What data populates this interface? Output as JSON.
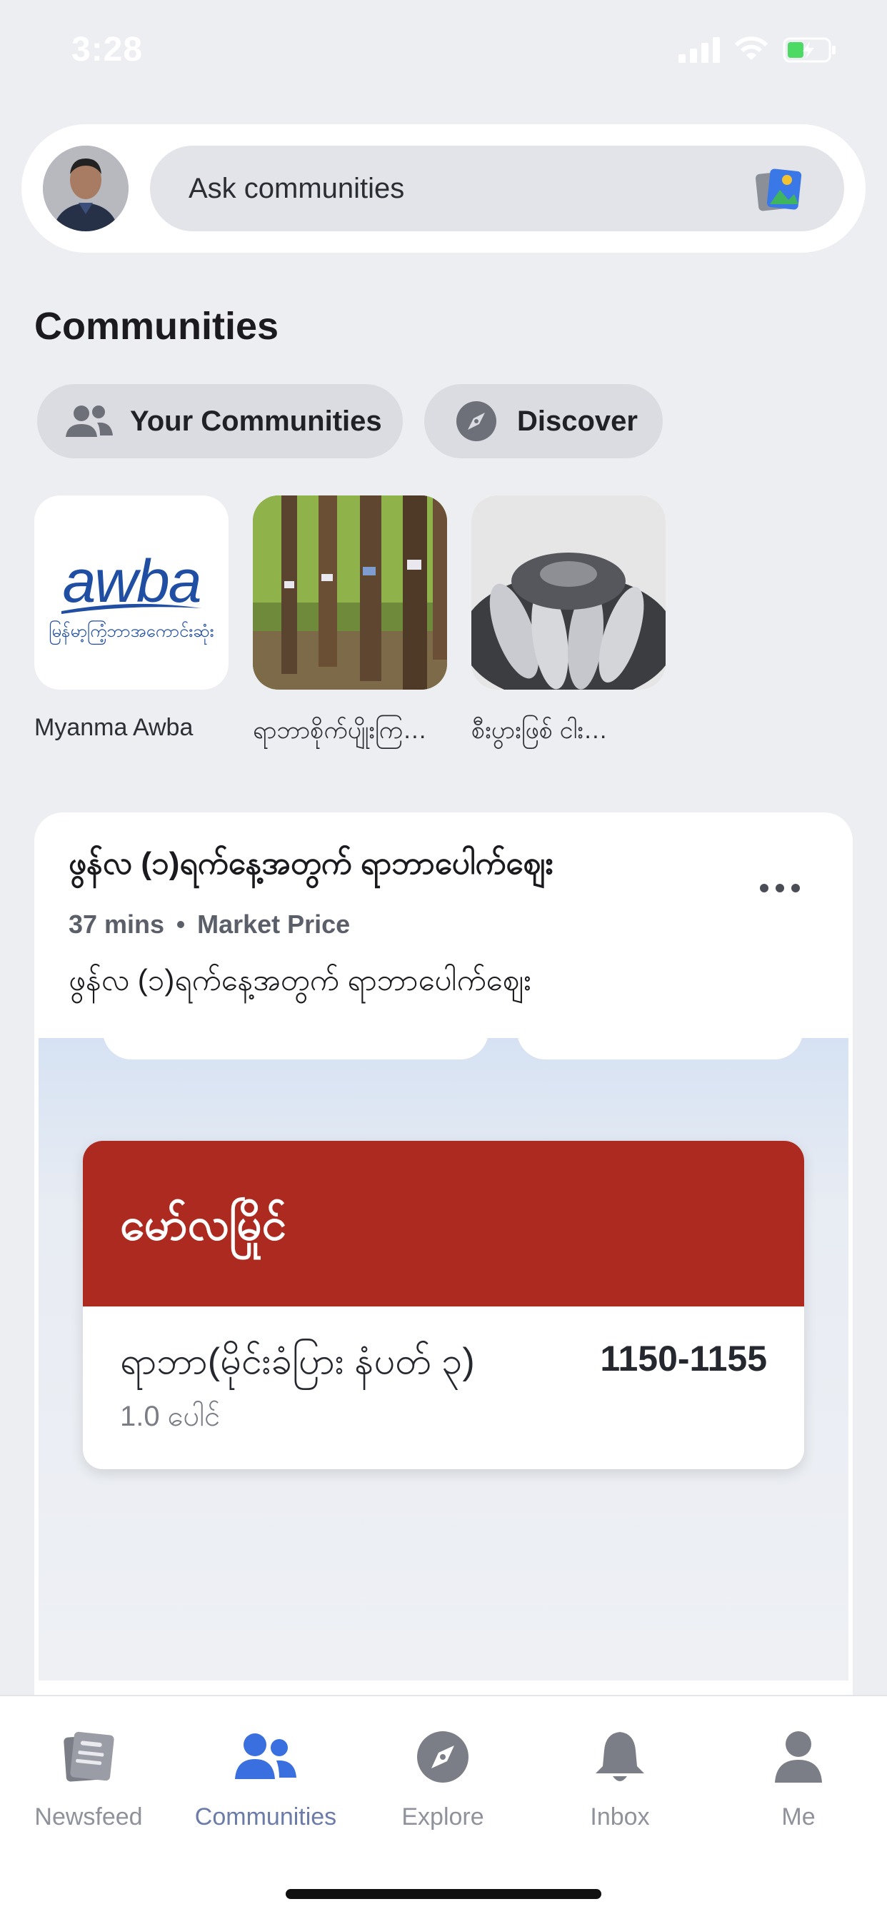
{
  "status_bar": {
    "time": "3:28"
  },
  "search": {
    "placeholder": "Ask communities"
  },
  "communities": {
    "title": "Communities",
    "chips": [
      {
        "label": "Your Communities",
        "icon": "people-icon"
      },
      {
        "label": "Discover",
        "icon": "compass-icon"
      }
    ],
    "items": [
      {
        "name": "Myanma Awba",
        "logo_text": "awba",
        "logo_subtext": "မြန်မာ့ကြံ့ဘာအကောင်းဆုံး"
      },
      {
        "name": "ရာဘာစိုက်ပျိုးကြ…"
      },
      {
        "name": "စီးပွားဖြစ် ငါး…"
      }
    ]
  },
  "post": {
    "title": "ဖွန်လ (၁)ရက်နေ့အတွက် ရာဘာပေါက်ဈေး",
    "time": "37 mins",
    "category": "Market Price",
    "body": "ဖွန်လ (၁)ရက်နေ့အတွက် ရာဘာပေါက်ဈေး",
    "price_card": {
      "city": "မော်လမြိုင်",
      "item": "ရာဘာ(မိုင်းခံပြား နံပတ် ၃)",
      "value": "1150-1155",
      "unit": "1.0 ပေါင်"
    }
  },
  "bottom_nav": [
    {
      "label": "Newsfeed",
      "icon": "newspaper-icon",
      "active": false
    },
    {
      "label": "Communities",
      "icon": "communities-icon",
      "active": true
    },
    {
      "label": "Explore",
      "icon": "compass-icon",
      "active": false
    },
    {
      "label": "Inbox",
      "icon": "bell-icon",
      "active": false
    },
    {
      "label": "Me",
      "icon": "person-icon",
      "active": false
    }
  ],
  "colors": {
    "accent": "#3a6fe0",
    "price_header": "#ad2a20",
    "background": "#eceef2"
  }
}
